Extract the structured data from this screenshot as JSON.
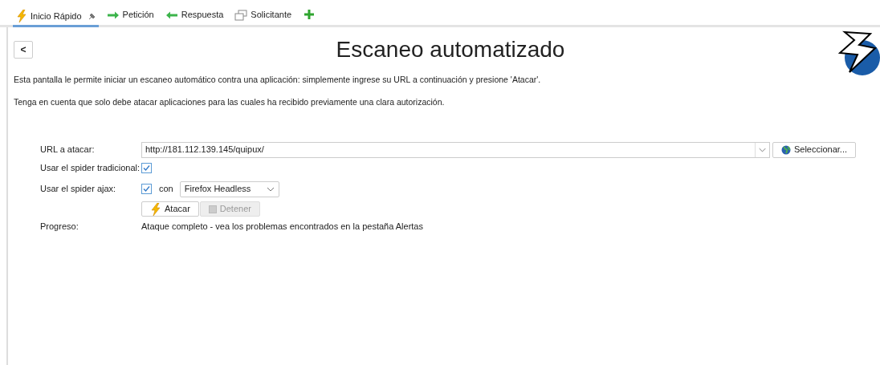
{
  "tabs": [
    {
      "label": "Inicio Rápido",
      "kind": "bolt",
      "selected": true,
      "pinned": true
    },
    {
      "label": "Petición",
      "kind": "right",
      "selected": false,
      "pinned": false
    },
    {
      "label": "Respuesta",
      "kind": "left",
      "selected": false,
      "pinned": false
    },
    {
      "label": "Solicitante",
      "kind": "windows",
      "selected": false,
      "pinned": false
    }
  ],
  "back_button": "<",
  "title": "Escaneo automatizado",
  "paragraphs": [
    "Esta pantalla le permite iniciar un escaneo automático contra una aplicación: simplemente ingrese su URL a continuación y presione 'Atacar'.",
    "Tenga en cuenta que solo debe atacar aplicaciones para las cuales ha recibido previamente una clara autorización."
  ],
  "url": {
    "label": "URL a atacar:",
    "value": "http://181.112.139.145/quipux/",
    "select_button": "Seleccionar..."
  },
  "traditional_spider": {
    "label": "Usar el spider tradicional:",
    "checked": true
  },
  "ajax_spider": {
    "label": "Usar el spider ajax:",
    "checked": true,
    "with": "con",
    "browser": "Firefox Headless"
  },
  "buttons": [
    {
      "label": "Atacar",
      "kind": "attack",
      "disabled": false
    },
    {
      "label": "Detener",
      "kind": "stop",
      "disabled": true
    }
  ],
  "progress": {
    "label": "Progreso:",
    "value": "Ataque completo - vea los problemas encontrados en la pestaña Alertas"
  }
}
